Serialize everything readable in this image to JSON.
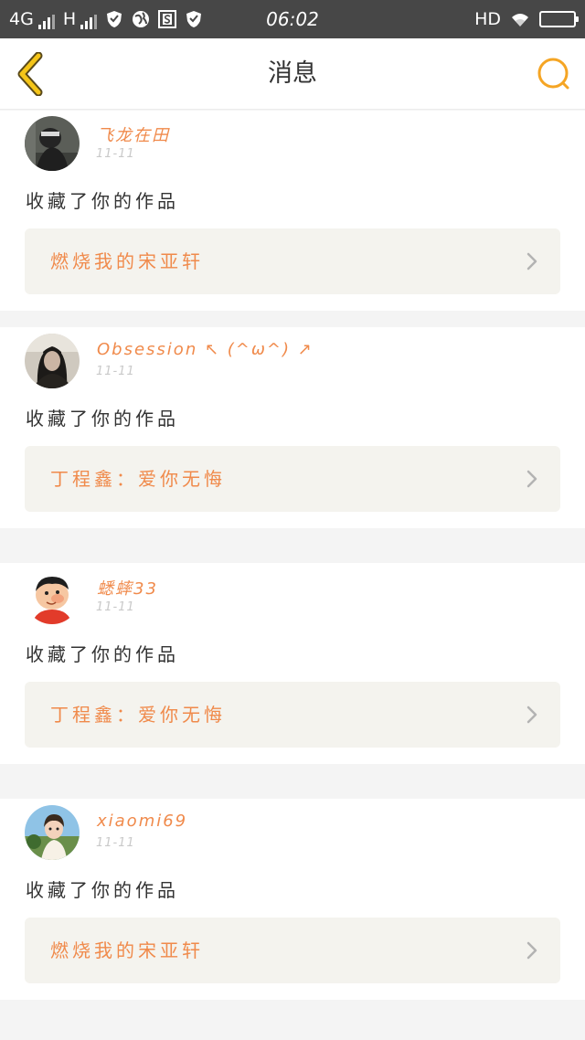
{
  "status_bar": {
    "network_left": "4G",
    "network_right": "H",
    "time": "06:02",
    "hd": "HD",
    "battery_level": 0.3
  },
  "header": {
    "title": "消息",
    "back_icon": "back-chevron-icon",
    "search_icon": "search-icon",
    "accent_color": "#f5a524"
  },
  "colors": {
    "username": "#f08a4b",
    "work_title": "#f08a4b",
    "work_link_bg": "#f4f3ee",
    "divider": "#f4f4f4",
    "status_bar_bg": "#474747"
  },
  "notifications": [
    {
      "username": "飞龙在田",
      "date": "11-11",
      "action": "收藏了你的作品",
      "work_title": "燃烧我的宋亚轩",
      "avatar": "dark-photo-avatar"
    },
    {
      "username": "Obsession ↖ (^ω^) ↗",
      "date": "11-11",
      "action": "收藏了你的作品",
      "work_title": "丁程鑫：爱你无悔",
      "avatar": "girl-photo-avatar"
    },
    {
      "username": "蟋蟀33",
      "date": "11-11",
      "action": "收藏了你的作品",
      "work_title": "丁程鑫：爱你无悔",
      "avatar": "cartoon-boy-avatar"
    },
    {
      "username": "xiaomi69",
      "date": "11-11",
      "action": "收藏了你的作品",
      "work_title": "燃烧我的宋亚轩",
      "avatar": "child-photo-avatar"
    }
  ]
}
